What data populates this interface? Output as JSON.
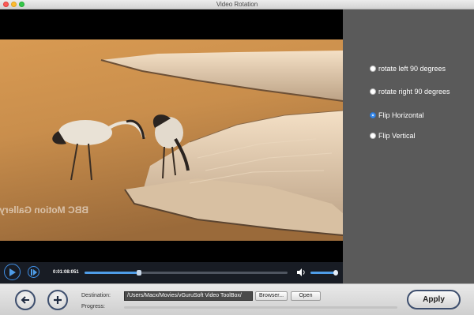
{
  "window": {
    "title": "Video Rotation"
  },
  "options": [
    {
      "label": "rotate left 90 degrees",
      "checked": false
    },
    {
      "label": "rotate right 90 degrees",
      "checked": false
    },
    {
      "label": "Flip Horizontal",
      "checked": true
    },
    {
      "label": "Flip Vertical",
      "checked": false
    }
  ],
  "player": {
    "time": "0:01:08:051",
    "seek_fraction": 0.27,
    "volume_fraction": 0.95
  },
  "video": {
    "watermark": "BBC Motion Gallery"
  },
  "bottom": {
    "destination_label": "Destination:",
    "destination_path": "/Users/Macx/Movies/vGuruSoft Video ToolBox/",
    "browse_label": "Browser...",
    "open_label": "Open",
    "progress_label": "Progress:",
    "progress_fraction": 0,
    "apply_label": "Apply"
  },
  "colors": {
    "accent": "#3f8fe6",
    "panel": "#5a5a5a",
    "player_bar": "#181c24"
  }
}
